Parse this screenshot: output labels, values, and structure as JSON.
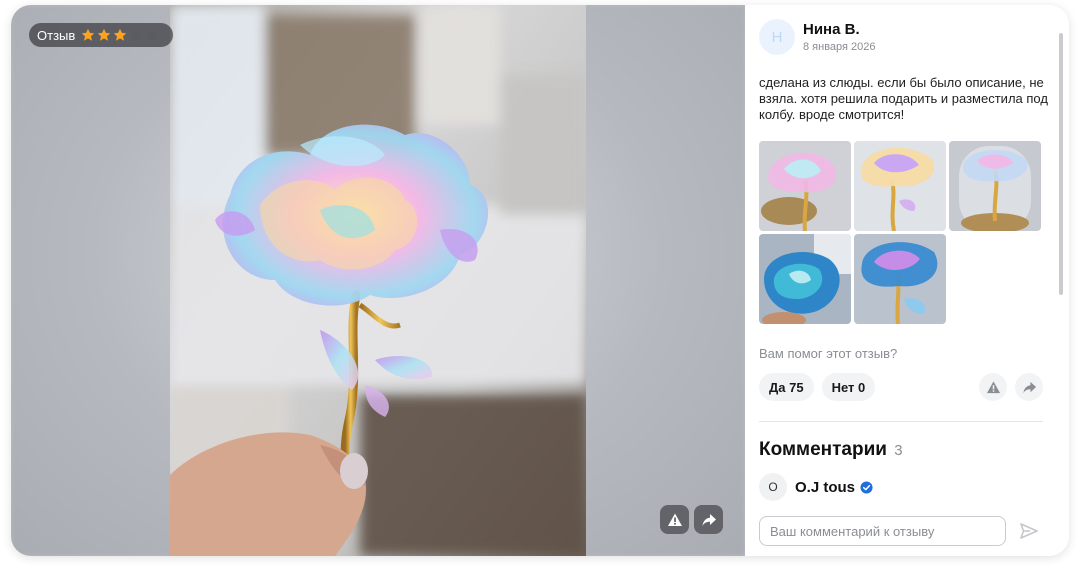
{
  "viewer": {
    "rating_label": "Отзыв",
    "rating": {
      "value": 3,
      "max": 5
    },
    "star_color": "#ffa31a",
    "star_empty_color": "#5a5a60"
  },
  "review": {
    "author": {
      "initial": "Н",
      "name": "Нина В.",
      "date": "8 января 2026"
    },
    "text": "сделана из слюды. если бы было описание, не взяла. хотя решила подарить и разместила под колбу. вроде смотрится!",
    "photos_count": 5,
    "helpful_question": "Вам помог этот отзыв?",
    "vote_yes": "Да 75",
    "vote_no": "Нет 0"
  },
  "comments": {
    "title": "Комментарии",
    "count": "3",
    "items": [
      {
        "initial": "O",
        "author": "O.J tous",
        "verified": true
      }
    ]
  },
  "composer": {
    "placeholder": "Ваш комментарий к отзыву"
  },
  "colors": {
    "accent": "#1e6fd9",
    "muted_text": "#8a8d94"
  }
}
